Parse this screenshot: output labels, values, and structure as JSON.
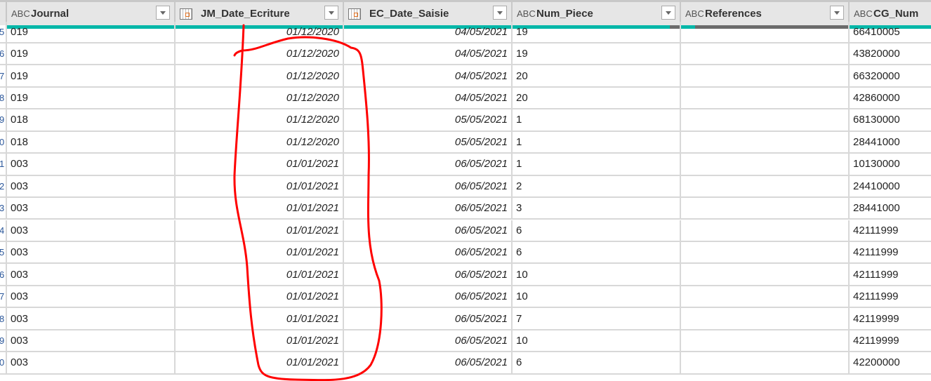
{
  "columns": [
    {
      "name": "Journal",
      "type_icon": "abc-text-icon"
    },
    {
      "name": "JM_Date_Ecriture",
      "type_icon": "calendar-icon"
    },
    {
      "name": "EC_Date_Saisie",
      "type_icon": "calendar-icon"
    },
    {
      "name": "Num_Piece",
      "type_icon": "abc-text-icon"
    },
    {
      "name": "References",
      "type_icon": "abc-text-icon"
    },
    {
      "name": "CG_Num",
      "type_icon": "abc-text-icon"
    }
  ],
  "type_icon_text": "ABC",
  "rows": [
    {
      "n": "5",
      "j": "019",
      "d1": "01/12/2020",
      "d2": "04/05/2021",
      "p": "19",
      "ref": "",
      "cg": "66410005"
    },
    {
      "n": "6",
      "j": "019",
      "d1": "01/12/2020",
      "d2": "04/05/2021",
      "p": "19",
      "ref": "",
      "cg": "43820000"
    },
    {
      "n": "7",
      "j": "019",
      "d1": "01/12/2020",
      "d2": "04/05/2021",
      "p": "20",
      "ref": "",
      "cg": "66320000"
    },
    {
      "n": "8",
      "j": "019",
      "d1": "01/12/2020",
      "d2": "04/05/2021",
      "p": "20",
      "ref": "",
      "cg": "42860000"
    },
    {
      "n": "9",
      "j": "018",
      "d1": "01/12/2020",
      "d2": "05/05/2021",
      "p": "1",
      "ref": "",
      "cg": "68130000"
    },
    {
      "n": "0",
      "j": "018",
      "d1": "01/12/2020",
      "d2": "05/05/2021",
      "p": "1",
      "ref": "",
      "cg": "28441000"
    },
    {
      "n": "1",
      "j": "003",
      "d1": "01/01/2021",
      "d2": "06/05/2021",
      "p": "1",
      "ref": "",
      "cg": "10130000"
    },
    {
      "n": "2",
      "j": "003",
      "d1": "01/01/2021",
      "d2": "06/05/2021",
      "p": "2",
      "ref": "",
      "cg": "24410000"
    },
    {
      "n": "3",
      "j": "003",
      "d1": "01/01/2021",
      "d2": "06/05/2021",
      "p": "3",
      "ref": "",
      "cg": "28441000"
    },
    {
      "n": "4",
      "j": "003",
      "d1": "01/01/2021",
      "d2": "06/05/2021",
      "p": "6",
      "ref": "",
      "cg": "42111999"
    },
    {
      "n": "5",
      "j": "003",
      "d1": "01/01/2021",
      "d2": "06/05/2021",
      "p": "6",
      "ref": "",
      "cg": "42111999"
    },
    {
      "n": "6",
      "j": "003",
      "d1": "01/01/2021",
      "d2": "06/05/2021",
      "p": "10",
      "ref": "",
      "cg": "42111999"
    },
    {
      "n": "7",
      "j": "003",
      "d1": "01/01/2021",
      "d2": "06/05/2021",
      "p": "10",
      "ref": "",
      "cg": "42111999"
    },
    {
      "n": "8",
      "j": "003",
      "d1": "01/01/2021",
      "d2": "06/05/2021",
      "p": "7",
      "ref": "",
      "cg": "42119999"
    },
    {
      "n": "9",
      "j": "003",
      "d1": "01/01/2021",
      "d2": "06/05/2021",
      "p": "10",
      "ref": "",
      "cg": "42119999"
    },
    {
      "n": "0",
      "j": "003",
      "d1": "01/01/2021",
      "d2": "06/05/2021",
      "p": "6",
      "ref": "",
      "cg": "42200000"
    }
  ],
  "colors": {
    "quality_valid": "#00b7a8",
    "quality_empty": "#6b6b6b",
    "annotation": "#ff0000"
  }
}
